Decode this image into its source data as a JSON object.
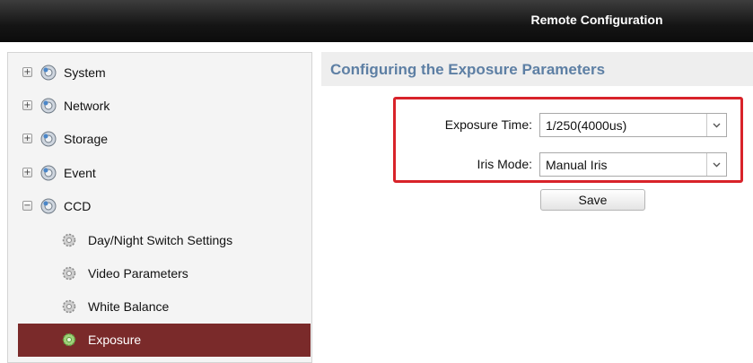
{
  "header": {
    "title": "Remote Configuration"
  },
  "sidebar": {
    "items": [
      {
        "label": "System",
        "toggle": "+"
      },
      {
        "label": "Network",
        "toggle": "+"
      },
      {
        "label": "Storage",
        "toggle": "+"
      },
      {
        "label": "Event",
        "toggle": "+"
      },
      {
        "label": "CCD",
        "toggle": "−"
      }
    ],
    "ccd_children": [
      {
        "label": "Day/Night Switch Settings"
      },
      {
        "label": "Video Parameters"
      },
      {
        "label": "White Balance"
      },
      {
        "label": "Exposure",
        "selected": true
      }
    ]
  },
  "main": {
    "heading": "Configuring the Exposure Parameters",
    "exposure_time": {
      "label": "Exposure Time:",
      "value": "1/250(4000us)"
    },
    "iris_mode": {
      "label": "Iris Mode:",
      "value": "Manual Iris"
    },
    "save_label": "Save"
  },
  "colors": {
    "selected_bg": "#7a2a2a",
    "heading_blue": "#5d7fa4",
    "highlight_red": "#d8232a"
  },
  "icons": {
    "tree_group": "globe-gear-icon",
    "tree_child": "gear-icon",
    "dropdown": "chevron-down-icon"
  }
}
